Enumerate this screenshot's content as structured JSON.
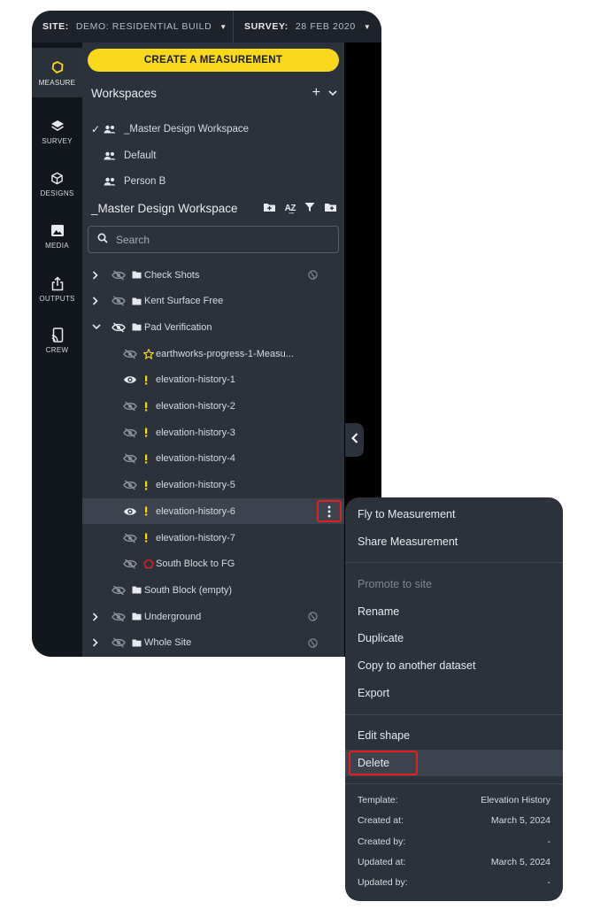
{
  "topbar": {
    "site_key": "SITE:",
    "site_value": "DEMO: RESIDENTIAL BUILD",
    "survey_key": "SURVEY:",
    "survey_value": "28 FEB 2020"
  },
  "rail": {
    "items": [
      {
        "label": "MEASURE",
        "icon": "measure-hexagon-icon",
        "active": true
      },
      {
        "label": "SURVEY",
        "icon": "layers-icon",
        "active": false
      },
      {
        "label": "DESIGNS",
        "icon": "cube-icon",
        "active": false
      },
      {
        "label": "MEDIA",
        "icon": "image-icon",
        "active": false
      },
      {
        "label": "OUTPUTS",
        "icon": "share-upload-icon",
        "active": false
      },
      {
        "label": "CREW",
        "icon": "device-cast-icon",
        "active": false
      }
    ]
  },
  "panel": {
    "create_button": "CREATE A MEASUREMENT",
    "workspaces_title": "Workspaces",
    "workspaces": [
      {
        "name": "_Master Design Workspace",
        "checked": true
      },
      {
        "name": "Default",
        "checked": false
      },
      {
        "name": "Person B",
        "checked": false
      }
    ],
    "section_title": "_Master Design Workspace",
    "search_placeholder": "Search",
    "tree": [
      {
        "name": "Check Shots",
        "kind": "folder",
        "expanded": false,
        "visible": false,
        "level": 0,
        "globe": true
      },
      {
        "name": "Kent Surface Free",
        "kind": "folder",
        "expanded": false,
        "visible": false,
        "level": 0,
        "globe": false
      },
      {
        "name": "Pad Verification",
        "kind": "folder",
        "expanded": true,
        "visible": false,
        "level": 0,
        "globe": false
      },
      {
        "name": "earthworks-progress-1-Measu...",
        "kind": "star",
        "visible": false,
        "level": 1
      },
      {
        "name": "elevation-history-1",
        "kind": "point",
        "visible": true,
        "level": 1
      },
      {
        "name": "elevation-history-2",
        "kind": "point",
        "visible": false,
        "level": 1
      },
      {
        "name": "elevation-history-3",
        "kind": "point",
        "visible": false,
        "level": 1
      },
      {
        "name": "elevation-history-4",
        "kind": "point",
        "visible": false,
        "level": 1
      },
      {
        "name": "elevation-history-5",
        "kind": "point",
        "visible": false,
        "level": 1
      },
      {
        "name": "elevation-history-6",
        "kind": "point",
        "visible": true,
        "level": 1,
        "selected": true
      },
      {
        "name": "elevation-history-7",
        "kind": "point",
        "visible": false,
        "level": 1
      },
      {
        "name": "South Block to FG",
        "kind": "polygon",
        "visible": false,
        "level": 1
      },
      {
        "name": "South Block  (empty)",
        "kind": "folder-empty",
        "visible": false,
        "level": 0,
        "globe": false
      },
      {
        "name": "Underground",
        "kind": "folder",
        "expanded": false,
        "visible": false,
        "level": 0,
        "globe": true
      },
      {
        "name": "Whole Site",
        "kind": "folder",
        "expanded": false,
        "visible": false,
        "level": 0,
        "globe": true
      }
    ]
  },
  "context_menu": {
    "group1": [
      "Fly to Measurement",
      "Share Measurement"
    ],
    "group2": [
      "Promote to site",
      "Rename",
      "Duplicate",
      "Copy to another dataset",
      "Export"
    ],
    "group3": [
      "Edit shape",
      "Delete"
    ],
    "meta": [
      {
        "label": "Template:",
        "value": "Elevation History"
      },
      {
        "label": "Created at:",
        "value": "March 5, 2024"
      },
      {
        "label": "Created by:",
        "value": "-"
      },
      {
        "label": "Updated at:",
        "value": "March 5, 2024"
      },
      {
        "label": "Updated by:",
        "value": "-"
      }
    ]
  },
  "colors": {
    "accent_yellow": "#f7d81b",
    "highlight_red": "#e41e1e",
    "panel_bg": "#2c323b",
    "rail_bg": "#12161d"
  }
}
